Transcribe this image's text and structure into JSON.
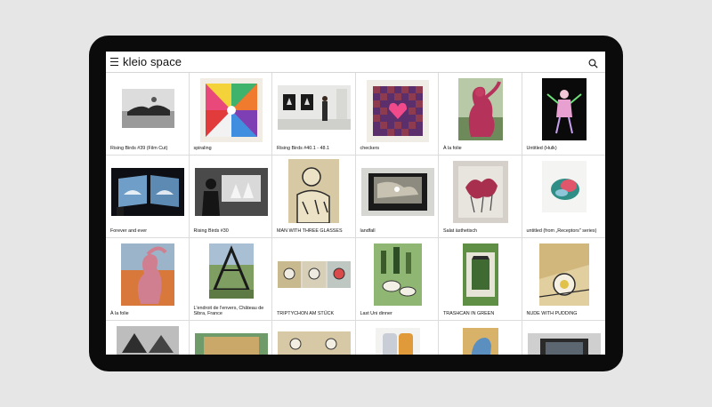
{
  "app": {
    "logo": "kleio space",
    "menu_icon": "hamburger-menu-icon",
    "search_icon": "search-icon"
  },
  "colors": {
    "device_bezel": "#0b0b0b",
    "background": "#e6e6e6",
    "grid_line": "#dcdcdc"
  },
  "artworks": [
    {
      "title": "Rising Birds #39 (Film Cut)"
    },
    {
      "title": "spiraling"
    },
    {
      "title": "Rising Birds #40.1 - 48.1"
    },
    {
      "title": "checkers"
    },
    {
      "title": "À la folie"
    },
    {
      "title": "Untitled (Hulk)"
    },
    {
      "title": "Forever and ever"
    },
    {
      "title": "Rising Birds #30"
    },
    {
      "title": "MAN WITH THREE GLASSES"
    },
    {
      "title": "landfall"
    },
    {
      "title": "Salat ästhetisch"
    },
    {
      "title": "untitled (from „Receptors\" series)"
    },
    {
      "title": "À la folie"
    },
    {
      "title": "L'endroit de l'envers, Château de Sibra, France"
    },
    {
      "title": "TRIPTYCHON AM STÜCK"
    },
    {
      "title": "Last Uni dinner"
    },
    {
      "title": "TRASHCAN IN GREEN"
    },
    {
      "title": "NUDE WITH PUDDING"
    },
    {
      "title": ""
    },
    {
      "title": ""
    },
    {
      "title": ""
    },
    {
      "title": ""
    },
    {
      "title": ""
    },
    {
      "title": ""
    }
  ]
}
